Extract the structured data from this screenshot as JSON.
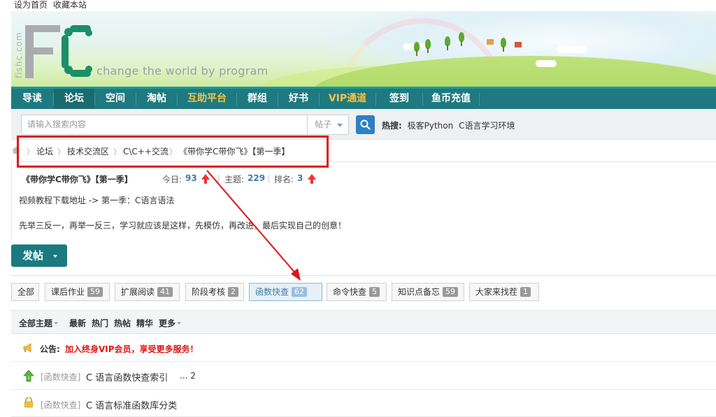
{
  "topbar": {
    "set_home": "设为首页",
    "bookmark": "收藏本站"
  },
  "header": {
    "logo_side": "fishc.com",
    "slogan": "change the world by program"
  },
  "nav": [
    {
      "label": "导读"
    },
    {
      "label": "论坛"
    },
    {
      "label": "空间"
    },
    {
      "label": "淘帖"
    },
    {
      "label": "互助平台"
    },
    {
      "label": "群组"
    },
    {
      "label": "好书"
    },
    {
      "label": "VIP通道"
    },
    {
      "label": "签到"
    },
    {
      "label": "鱼币充值"
    }
  ],
  "search": {
    "placeholder": "请输入搜索内容",
    "type": "帖子",
    "hot_label": "热搜:",
    "hot_items": [
      "极客Python",
      "C语言学习环境"
    ]
  },
  "breadcrumb": [
    "论坛",
    "技术交流区",
    "C\\C++交流",
    "《带你学C带你飞》【第一季】"
  ],
  "forum": {
    "title": "《带你学C带你飞》【第一季】",
    "today_label": "今日:",
    "today": "93",
    "topics_label": "主题:",
    "topics": "229",
    "rank_label": "排名:",
    "rank": "3",
    "line1": "视频教程下载地址 -> 第一季：C语言语法",
    "line2": "先举三反一，再举一反三，学习就应该是这样，先模仿，再改进，最后实现自己的创意！"
  },
  "post_button": "发帖",
  "tabs": [
    {
      "label": "全部",
      "count": ""
    },
    {
      "label": "课后作业",
      "count": "59"
    },
    {
      "label": "扩展阅读",
      "count": "41"
    },
    {
      "label": "阶段考核",
      "count": "2"
    },
    {
      "label": "函数快查",
      "count": "62"
    },
    {
      "label": "命令快查",
      "count": "5"
    },
    {
      "label": "知识点备忘",
      "count": "59"
    },
    {
      "label": "大家来找茬",
      "count": "1"
    }
  ],
  "thread_head": {
    "all": "全部主题",
    "latest": "最新",
    "hot": "热门",
    "hotpost": "热帖",
    "digest": "精华",
    "more": "更多"
  },
  "notice": {
    "label": "公告:",
    "text": "加入终身VIP会员，享受更多服务！"
  },
  "threads": [
    {
      "category": "[函数快查]",
      "title": "C 语言函数快查索引",
      "pages": "... 2"
    },
    {
      "category": "[函数快查]",
      "title": "C 语言标准函数库分类",
      "pages": ""
    }
  ],
  "colors": {
    "nav_bg": "#1e7a80",
    "accent_gold": "#f6c344",
    "annotation_red": "#e01414",
    "link_blue": "#3c7ea4"
  }
}
